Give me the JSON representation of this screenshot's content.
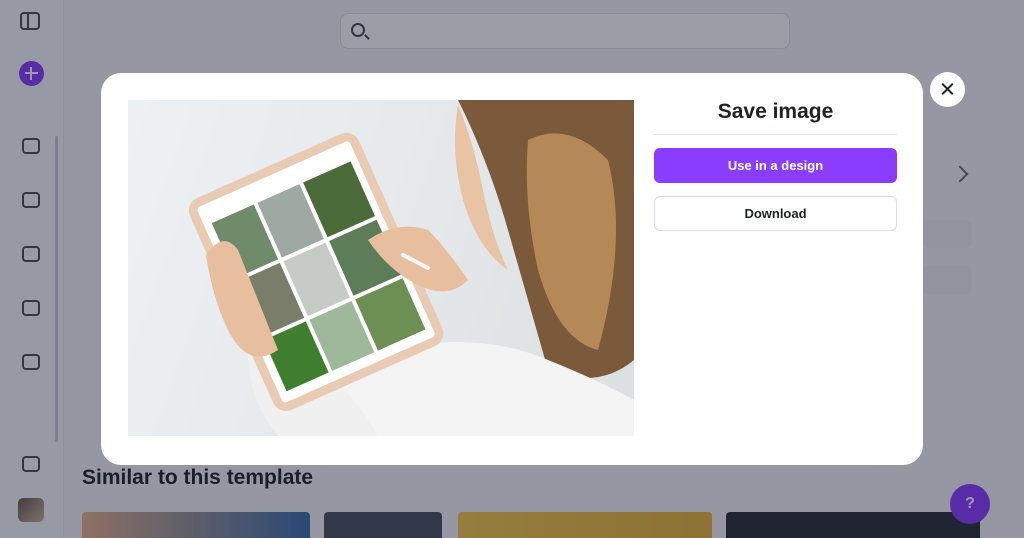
{
  "modal": {
    "title": "Save image",
    "primary_button": "Use in a design",
    "secondary_button": "Download",
    "close_icon": "close-icon"
  },
  "background": {
    "heading": "Similar to this template",
    "accent_color": "#8b3dff"
  },
  "icons": [
    "sidebar-toggle-icon",
    "plus-icon",
    "search-icon",
    "close-icon",
    "help-icon"
  ]
}
